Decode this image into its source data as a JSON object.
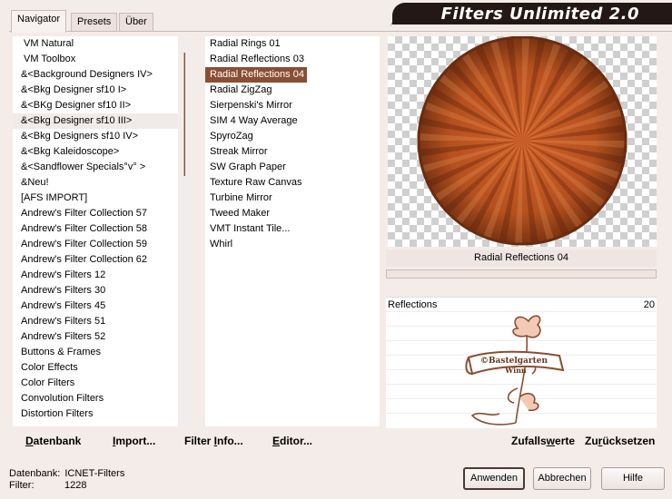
{
  "app": {
    "title": "Filters Unlimited 2.0"
  },
  "tabs": [
    {
      "label": "Navigator",
      "active": true
    },
    {
      "label": "Presets",
      "active": false
    },
    {
      "label": "Über",
      "active": false
    }
  ],
  "categories": [
    "VM Natural",
    "VM Toolbox",
    "&<Background Designers IV>",
    "&<Bkg Designer sf10 I>",
    "&<BKg Designer sf10 II>",
    "&<Bkg Designer sf10 III>",
    "&<Bkg Designers sf10 IV>",
    "&<Bkg Kaleidoscope>",
    "&<Sandflower Specials°v° >",
    "&Neu!",
    "[AFS IMPORT]",
    "Andrew's Filter Collection 57",
    "Andrew's Filter Collection 58",
    "Andrew's Filter Collection 59",
    "Andrew's Filter Collection 62",
    "Andrew's Filters 12",
    "Andrew's Filters 30",
    "Andrew's Filters 45",
    "Andrew's Filters 51",
    "Andrew's Filters 52",
    "Buttons & Frames",
    "Color Effects",
    "Color Filters",
    "Convolution Filters",
    "Distortion Filters"
  ],
  "filters": [
    "Radial  Rings 01",
    "Radial Reflections 03",
    "Radial Reflections 04",
    "Radial ZigZag",
    "Sierpenski's Mirror",
    "SIM 4 Way Average",
    "SpyroZag",
    "Streak Mirror",
    "SW Graph Paper",
    "Texture Raw Canvas",
    "Turbine Mirror",
    "Tweed Maker",
    "VMT Instant Tile...",
    "Whirl"
  ],
  "selected_filter": "Radial Reflections 04",
  "param": {
    "label": "Reflections",
    "value": "20"
  },
  "watermark": {
    "line1": "©Bastelgarten",
    "line2": "Winn"
  },
  "actions": {
    "database_first": "D",
    "database_rest": "atenbank",
    "import_first": "I",
    "import_rest": "mport...",
    "info_pre": "Filter ",
    "info_u": "I",
    "info_post": "nfo...",
    "editor_first": "E",
    "editor_rest": "ditor...",
    "random_pre": "Zufalls",
    "random_u": "w",
    "random_post": "erte",
    "reset_pre": "Zu",
    "reset_u": "r",
    "reset_post": "ücksetzen"
  },
  "status": {
    "db_label": "Datenbank:",
    "db_value": "ICNET-Filters",
    "filter_label": "Filter:",
    "filter_value": "1228"
  },
  "buttons": {
    "apply": "Anwenden",
    "cancel": "Abbrechen",
    "help": "Hilfe"
  },
  "colors": {
    "accent": "#8a4e32",
    "title_bg": "#231815",
    "sphere": "#b5511f"
  }
}
